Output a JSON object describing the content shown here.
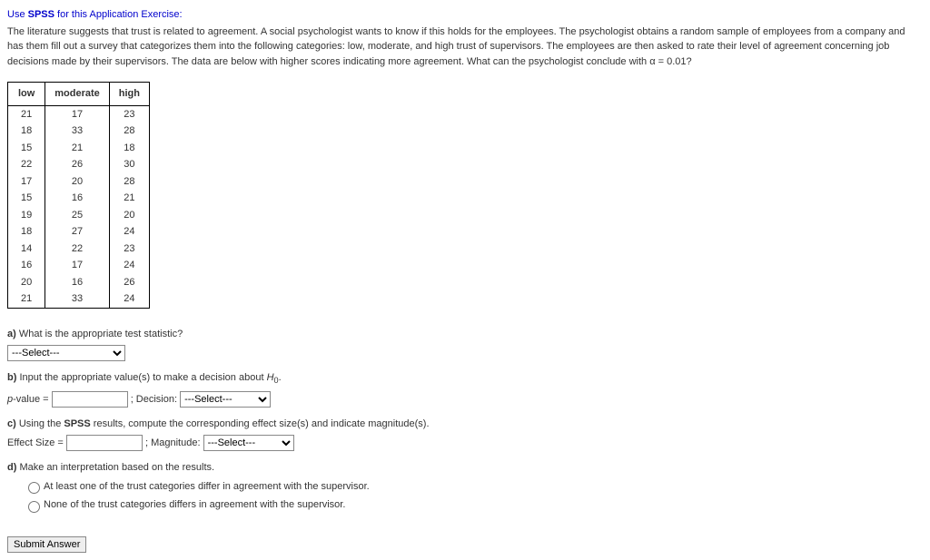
{
  "header": {
    "prefix": "Use ",
    "bold": "SPSS",
    "suffix": " for this Application Exercise:"
  },
  "description": "The literature suggests that trust is related to agreement. A social psychologist wants to know if this holds for the employees. The psychologist obtains a random sample of employees from a company and has them fill out a survey that categorizes them into the following categories: low, moderate, and high trust of supervisors. The employees are then asked to rate their level of agreement concerning job decisions made by their supervisors. The data are below with higher scores indicating more agreement. What can the psychologist conclude with α = 0.01?",
  "table": {
    "headers": [
      "low",
      "moderate",
      "high"
    ],
    "rows": [
      [
        "21",
        "17",
        "23"
      ],
      [
        "18",
        "33",
        "28"
      ],
      [
        "15",
        "21",
        "18"
      ],
      [
        "22",
        "26",
        "30"
      ],
      [
        "17",
        "20",
        "28"
      ],
      [
        "15",
        "16",
        "21"
      ],
      [
        "19",
        "25",
        "20"
      ],
      [
        "18",
        "27",
        "24"
      ],
      [
        "14",
        "22",
        "23"
      ],
      [
        "16",
        "17",
        "24"
      ],
      [
        "20",
        "16",
        "26"
      ],
      [
        "21",
        "33",
        "24"
      ]
    ]
  },
  "qa": {
    "label": "a)",
    "text": " What is the appropriate test statistic?",
    "select_placeholder": "---Select---"
  },
  "qb": {
    "label": "b)",
    "text1": " Input the appropriate value(s) to make a decision about ",
    "h0": "H",
    "sub0": "0",
    "dot": ".",
    "pval_label": "p",
    "pval_eq": "-value = ",
    "decision_pre": " ;  Decision: ",
    "select_placeholder": "---Select---"
  },
  "qc": {
    "label": "c)",
    "text1": " Using the ",
    "bold": "SPSS",
    "text2": " results, compute the corresponding effect size(s) and indicate magnitude(s).",
    "es_label": "Effect Size = ",
    "mag_pre": " ;  Magnitude: ",
    "select_placeholder": "---Select---"
  },
  "qd": {
    "label": "d)",
    "text": " Make an interpretation based on the results.",
    "opt1": "At least one of the trust categories differ in agreement with the supervisor.",
    "opt2": "None of the trust categories differs in agreement with the supervisor."
  },
  "submit": "Submit Answer"
}
